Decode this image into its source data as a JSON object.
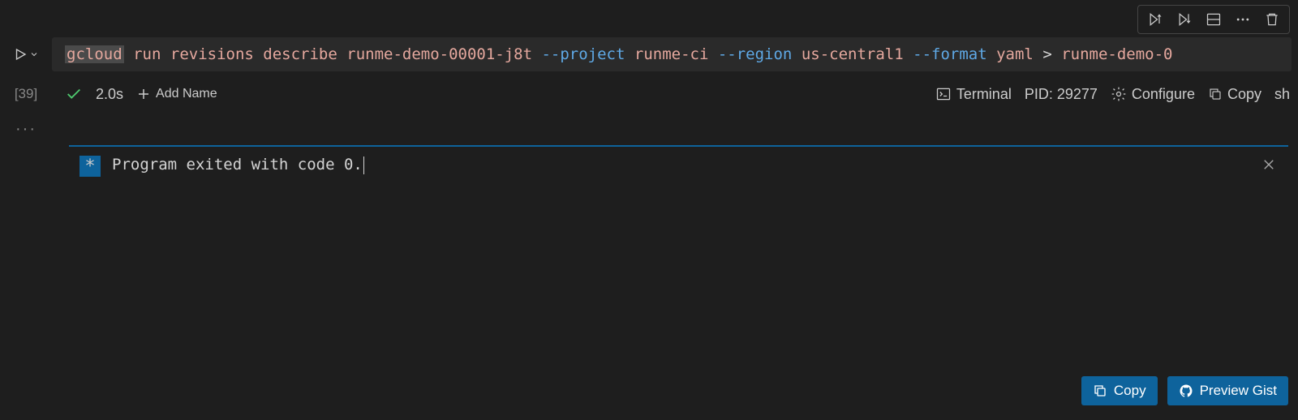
{
  "cell_index": "[39]",
  "code": {
    "command": "gcloud",
    "args": [
      "run",
      "revisions",
      "describe",
      "runme-demo-00001-j8t"
    ],
    "options": [
      {
        "flag": "--project",
        "value": "runme-ci"
      },
      {
        "flag": "--region",
        "value": "us-central1"
      },
      {
        "flag": "--format",
        "value": "yaml"
      }
    ],
    "redirect": ">",
    "output_target": "runme-demo-0"
  },
  "meta": {
    "duration": "2.0s",
    "add_name_label": "Add Name",
    "terminal_label": "Terminal",
    "pid_label": "PID: 29277",
    "configure_label": "Configure",
    "copy_label": "Copy",
    "shell_label": "sh"
  },
  "output": {
    "badge": "*",
    "text": "Program exited with code 0."
  },
  "actions": {
    "copy_label": "Copy",
    "gist_label": "Preview Gist"
  },
  "colors": {
    "accent": "#0e639c",
    "success": "#4ec96e",
    "fg": "#cccccc",
    "bg": "#1e1e1e",
    "code_bg": "#2a2a2a",
    "keyword": "#e5a89e",
    "flag": "#5fa9e6"
  }
}
